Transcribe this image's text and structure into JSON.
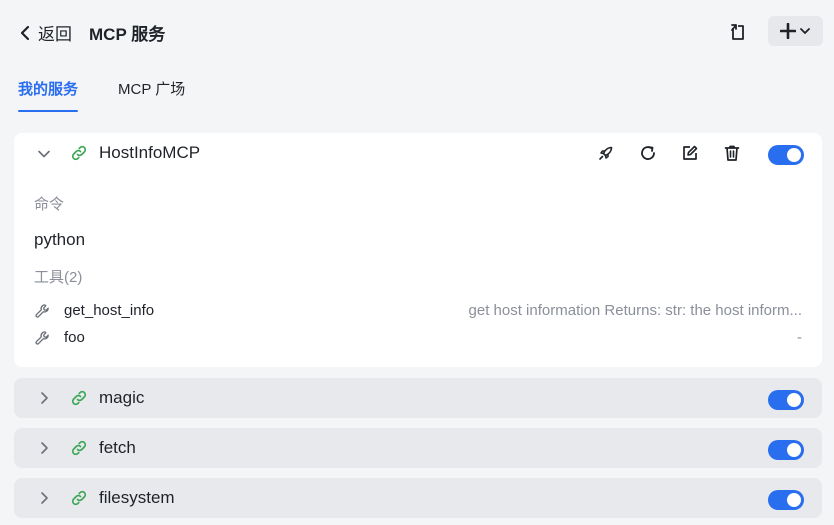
{
  "header": {
    "back_label": "返回",
    "title": "MCP 服务"
  },
  "tabs": [
    {
      "label": "我的服务",
      "active": true
    },
    {
      "label": "MCP 广场",
      "active": false
    }
  ],
  "servers": [
    {
      "name": "HostInfoMCP",
      "expanded": true,
      "enabled": true,
      "command_label": "命令",
      "command": "python",
      "tools_label": "工具(2)",
      "tools": [
        {
          "name": "get_host_info",
          "description": "get host information Returns: str: the host inform..."
        },
        {
          "name": "foo",
          "description": "-"
        }
      ]
    },
    {
      "name": "magic",
      "expanded": false,
      "enabled": true
    },
    {
      "name": "fetch",
      "expanded": false,
      "enabled": true
    },
    {
      "name": "filesystem",
      "expanded": false,
      "enabled": true
    }
  ],
  "colors": {
    "accent": "#2a6ef0",
    "link_icon": "#3aa655",
    "page_bg": "#f4f5f7",
    "collapsed_card_bg": "#e8e9ec"
  }
}
